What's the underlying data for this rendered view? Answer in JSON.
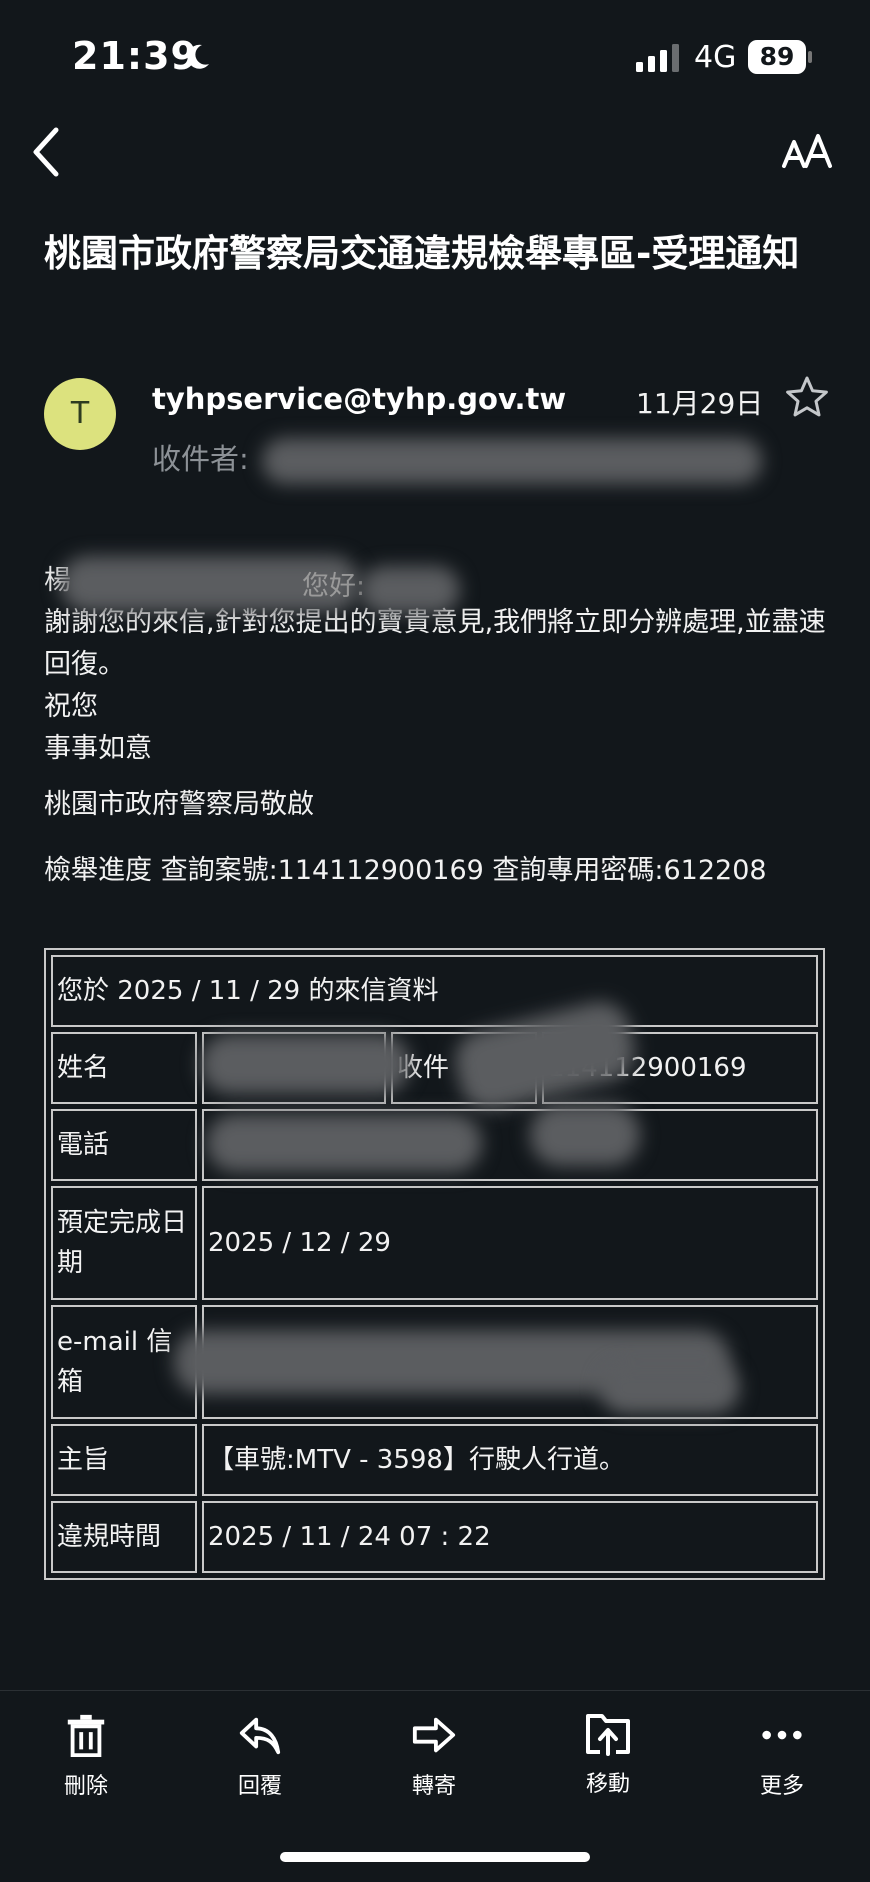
{
  "status_bar": {
    "time": "21:39",
    "network": "4G",
    "battery": "89"
  },
  "email": {
    "subject": "桃園市政府警察局交通違規檢舉專區-受理通知",
    "avatar_letter": "T",
    "sender": "tyhpservice@tyhp.gov.tw",
    "date": "11月29日",
    "recipient_label": "收件者:",
    "body": {
      "greeting_initial": "楊",
      "greeting_suffix": "您好:",
      "line1": "謝謝您的來信,針對您提出的寶貴意見,我們將立即分辨處理,並盡速回復。",
      "line2": "祝您",
      "line3": "事事如意",
      "signature": "桃園市政府警察局敬啟",
      "case_line": "檢舉進度 查詢案號:114112900169 查詢專用密碼:612208"
    },
    "table": {
      "header": "您於 2025 / 11 / 29 的來信資料",
      "name_label": "姓名",
      "receipt_label": "收件",
      "receipt_value": "114112900169",
      "phone_label": "電話",
      "due_label": "預定完成日期",
      "due_value": "2025 / 12 / 29",
      "email_label": "e-mail 信箱",
      "subject_label": "主旨",
      "subject_value": "【車號:MTV - 3598】行駛人行道。",
      "violation_time_label": "違規時間",
      "violation_time_value": "2025 / 11 / 24 07 : 22"
    }
  },
  "toolbar": {
    "delete": "刪除",
    "reply": "回覆",
    "forward": "轉寄",
    "move": "移動",
    "more": "更多"
  },
  "colors": {
    "background": "#12171b",
    "avatar": "#dce27e",
    "text": "#f2f2f2",
    "muted": "#8c9196",
    "table_border": "#c9c9c9"
  }
}
